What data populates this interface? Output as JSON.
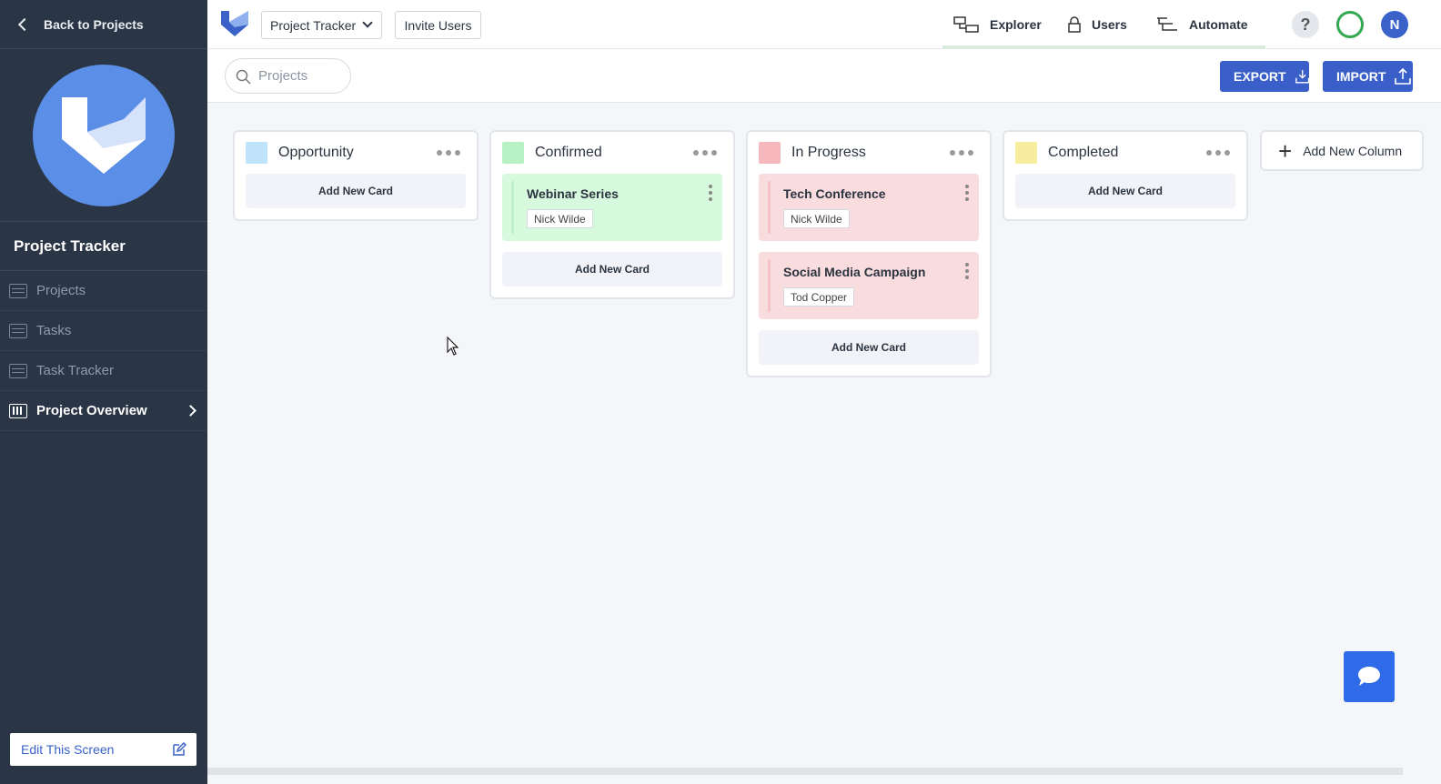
{
  "sidebar": {
    "back_label": "Back to Projects",
    "project_title": "Project Tracker",
    "items": [
      {
        "label": "Projects",
        "icon": "list-icon"
      },
      {
        "label": "Tasks",
        "icon": "list-icon"
      },
      {
        "label": "Task Tracker",
        "icon": "gantt-icon"
      },
      {
        "label": "Project Overview",
        "icon": "board-icon",
        "active": true
      }
    ],
    "edit_label": "Edit This Screen"
  },
  "topbar": {
    "project_select": "Project Tracker",
    "invite_label": "Invite Users",
    "nav": [
      {
        "label": "Explorer",
        "icon": "explorer-icon"
      },
      {
        "label": "Users",
        "icon": "lock-icon"
      },
      {
        "label": "Automate",
        "icon": "automate-icon"
      }
    ],
    "help": "?",
    "avatar_initial": "N"
  },
  "toolbar": {
    "search_placeholder": "Projects",
    "export_label": "EXPORT",
    "import_label": "IMPORT"
  },
  "board": {
    "columns": [
      {
        "title": "Opportunity",
        "color": "#bfe3fb",
        "cards": [],
        "add_label": "Add New Card"
      },
      {
        "title": "Confirmed",
        "color": "#b6f2c4",
        "cards": [
          {
            "title": "Webinar Series",
            "assignee": "Nick Wilde",
            "bg": "#d7f9de",
            "stripe": "#bfeec9"
          }
        ],
        "add_label": "Add New Card"
      },
      {
        "title": "In Progress",
        "color": "#f6b8bc",
        "cards": [
          {
            "title": "Tech Conference",
            "assignee": "Nick Wilde",
            "bg": "#f9dcdd",
            "stripe": "#f2c2c4"
          },
          {
            "title": "Social Media Campaign",
            "assignee": "Tod Copper",
            "bg": "#f9dcdd",
            "stripe": "#f2c2c4"
          }
        ],
        "add_label": "Add New Card"
      },
      {
        "title": "Completed",
        "color": "#f8ec9f",
        "cards": [],
        "add_label": "Add New Card"
      }
    ],
    "add_column_label": "Add New Column"
  },
  "colors": {
    "sidebar_bg": "#2a3646",
    "accent": "#3a5fc9",
    "chat": "#2f6be8"
  }
}
